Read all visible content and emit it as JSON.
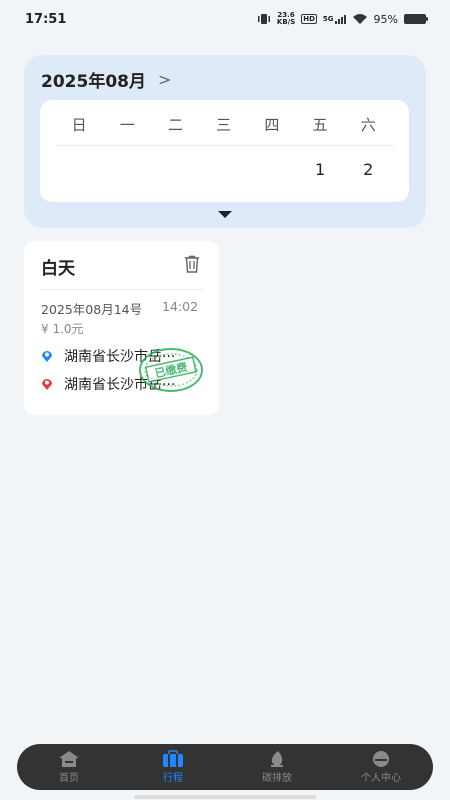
{
  "status_bar": {
    "time": "17:51",
    "net_speed_value": "23.6",
    "net_speed_unit": "KB/S",
    "hd": "HD",
    "signal": "5G",
    "battery": "95%"
  },
  "calendar": {
    "month_title": "2025年08月",
    "weekdays": [
      "日",
      "一",
      "二",
      "三",
      "四",
      "五",
      "六"
    ],
    "days": [
      "",
      "",
      "",
      "",
      "",
      "1",
      "2"
    ]
  },
  "trip": {
    "title": "白天",
    "date": "2025年08月14号",
    "time": "14:02",
    "price": "¥ 1.0元",
    "origin": "湖南省长沙市岳···",
    "destination": "湖南省长沙市岳···",
    "stamp_text": "已缴费"
  },
  "tabs": [
    {
      "label": "首页",
      "icon": "home-icon",
      "active": false
    },
    {
      "label": "行程",
      "icon": "briefcase-icon",
      "active": true
    },
    {
      "label": "碳排放",
      "icon": "leaf-icon",
      "active": false
    },
    {
      "label": "个人中心",
      "icon": "profile-icon",
      "active": false
    }
  ],
  "colors": {
    "accent": "#1e88ff",
    "calendar_bg": "#dfeaf8",
    "origin_pin": "#1e88ff",
    "destination_pin": "#e23b3b",
    "stamp": "#2fae5a"
  }
}
